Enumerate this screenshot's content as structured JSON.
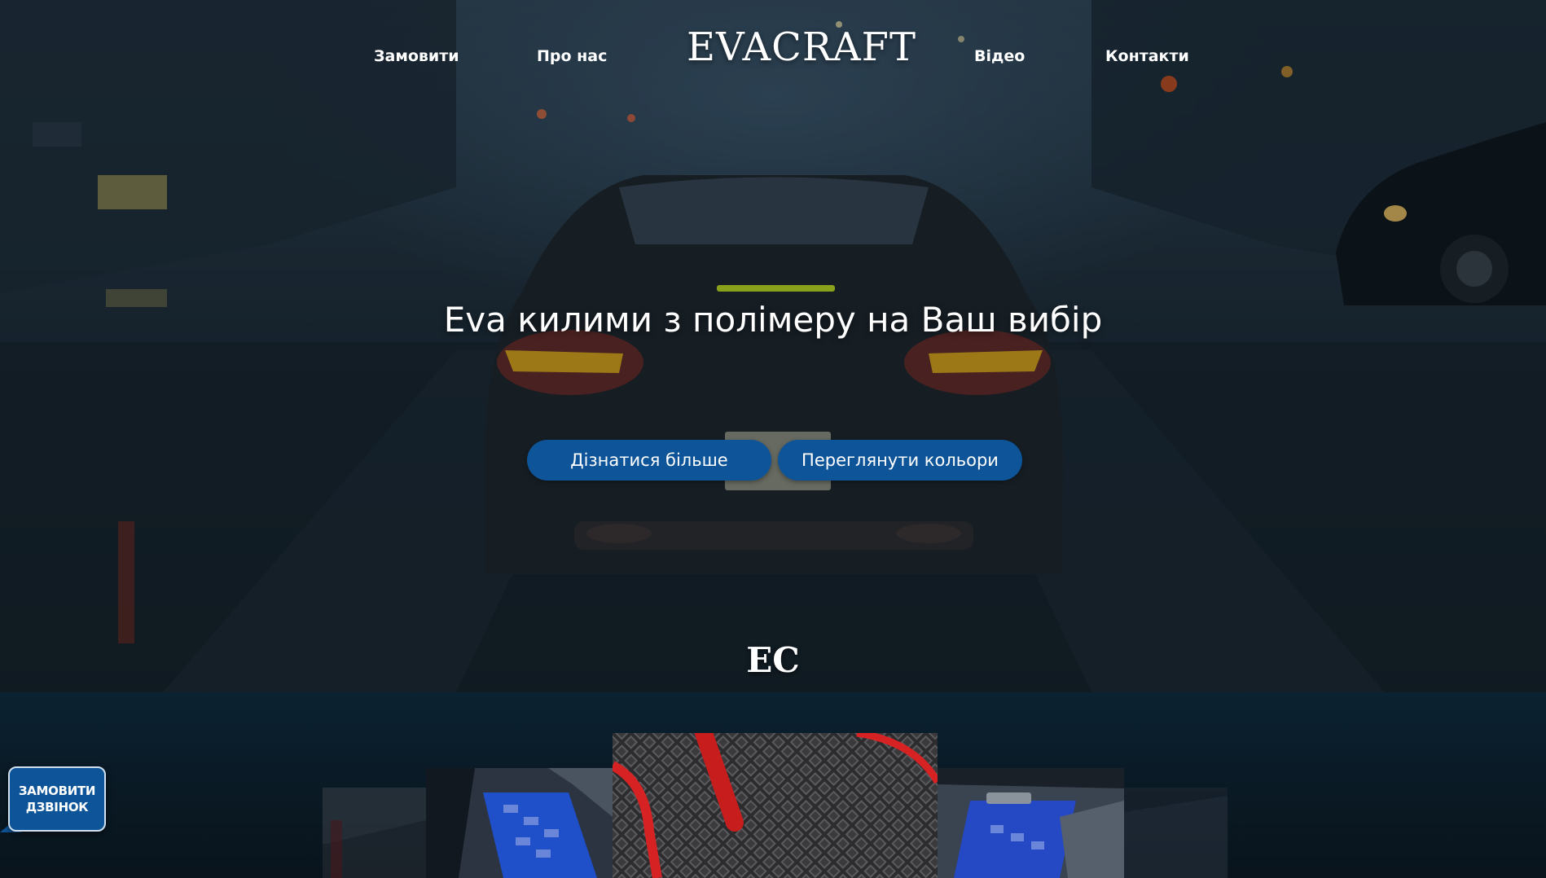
{
  "nav": {
    "order_label": "Замовити",
    "about_label": "Про нас",
    "logo": "EVACRAFT",
    "video_label": "Відео",
    "contacts_label": "Контакти"
  },
  "hero": {
    "headline": "Eva килими з полімеру на Ваш вибір",
    "learn_more_label": "Дізнатися більше",
    "view_colors_label": "Переглянути кольори",
    "monogram": "EC"
  },
  "callback": {
    "line1": "ЗАМОВИТИ",
    "line2": "ДЗВІНОК"
  },
  "colors": {
    "accent": "#0e5499",
    "background": "#0a1620"
  }
}
